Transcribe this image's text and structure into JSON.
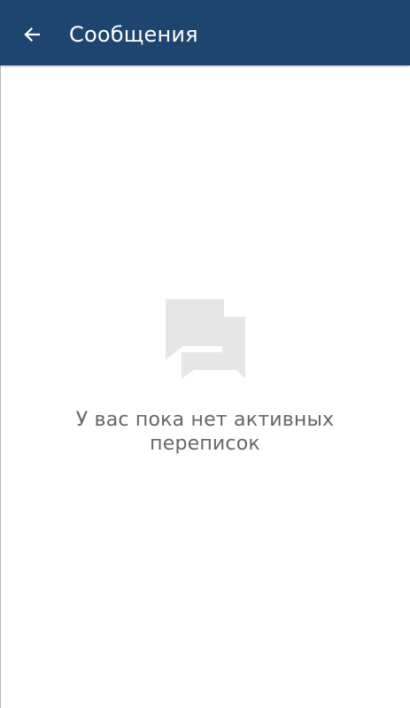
{
  "app_bar": {
    "title": "Сообщения",
    "background_color": "#1e4570",
    "back_icon": "arrow-left-icon"
  },
  "empty_state": {
    "icon": "chat-bubbles-icon",
    "icon_color": "#e6e6e6",
    "message_line1": "У вас пока нет активных",
    "message_line2": "переписок"
  }
}
